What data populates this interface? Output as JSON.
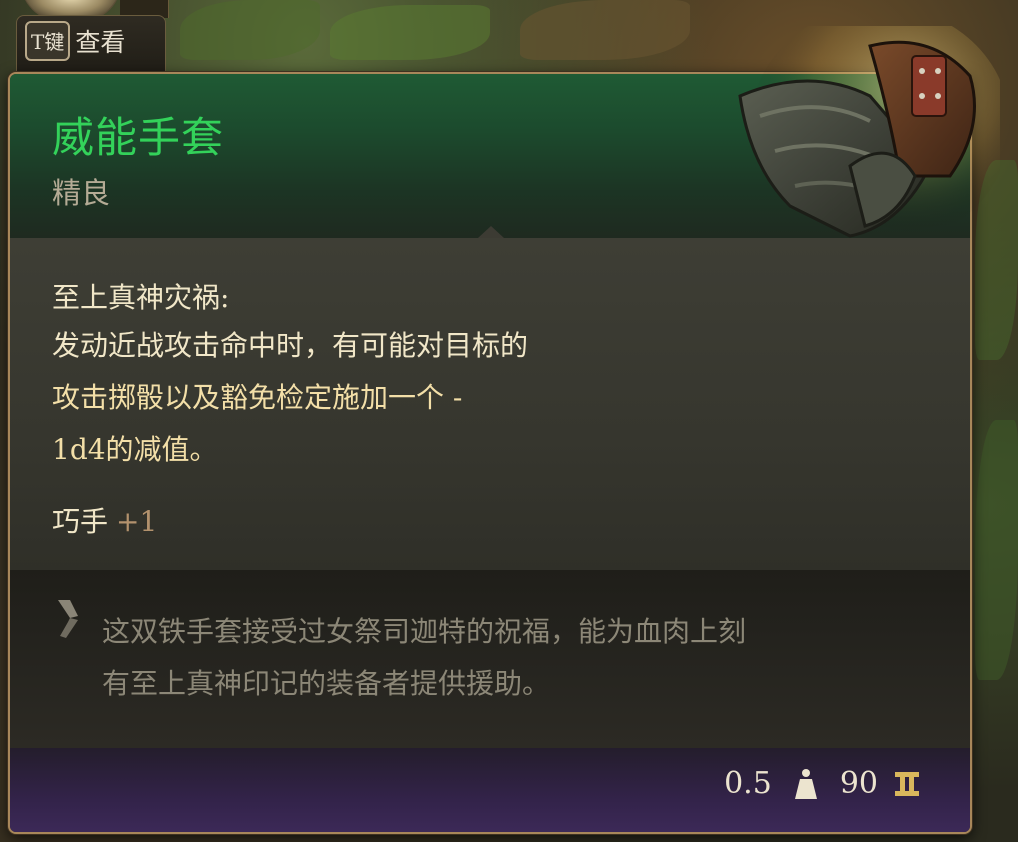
{
  "key_hint": {
    "key": "T键",
    "label": "查看"
  },
  "item": {
    "name": "威能手套",
    "rarity": "精良",
    "rarity_color": "#33d25a",
    "passive_title": "至上真神灾祸:",
    "passive_lines": [
      "发动近战攻击命中时，有可能对目标的",
      "攻击掷骰以及豁免检定施加一个 -",
      "1d4的减值。"
    ],
    "stat_name": "巧手",
    "stat_value": "+1",
    "lore_lines": [
      "这双铁手套接受过女祭司迦特的祝福，能为血肉上刻",
      "有至上真神印记的装备者提供援助。"
    ],
    "weight": "0.5",
    "price": "90"
  },
  "icons": {
    "lore": "scroll-icon",
    "weight": "weight-icon",
    "price": "coin-icon",
    "item": "gauntlet-icon"
  }
}
